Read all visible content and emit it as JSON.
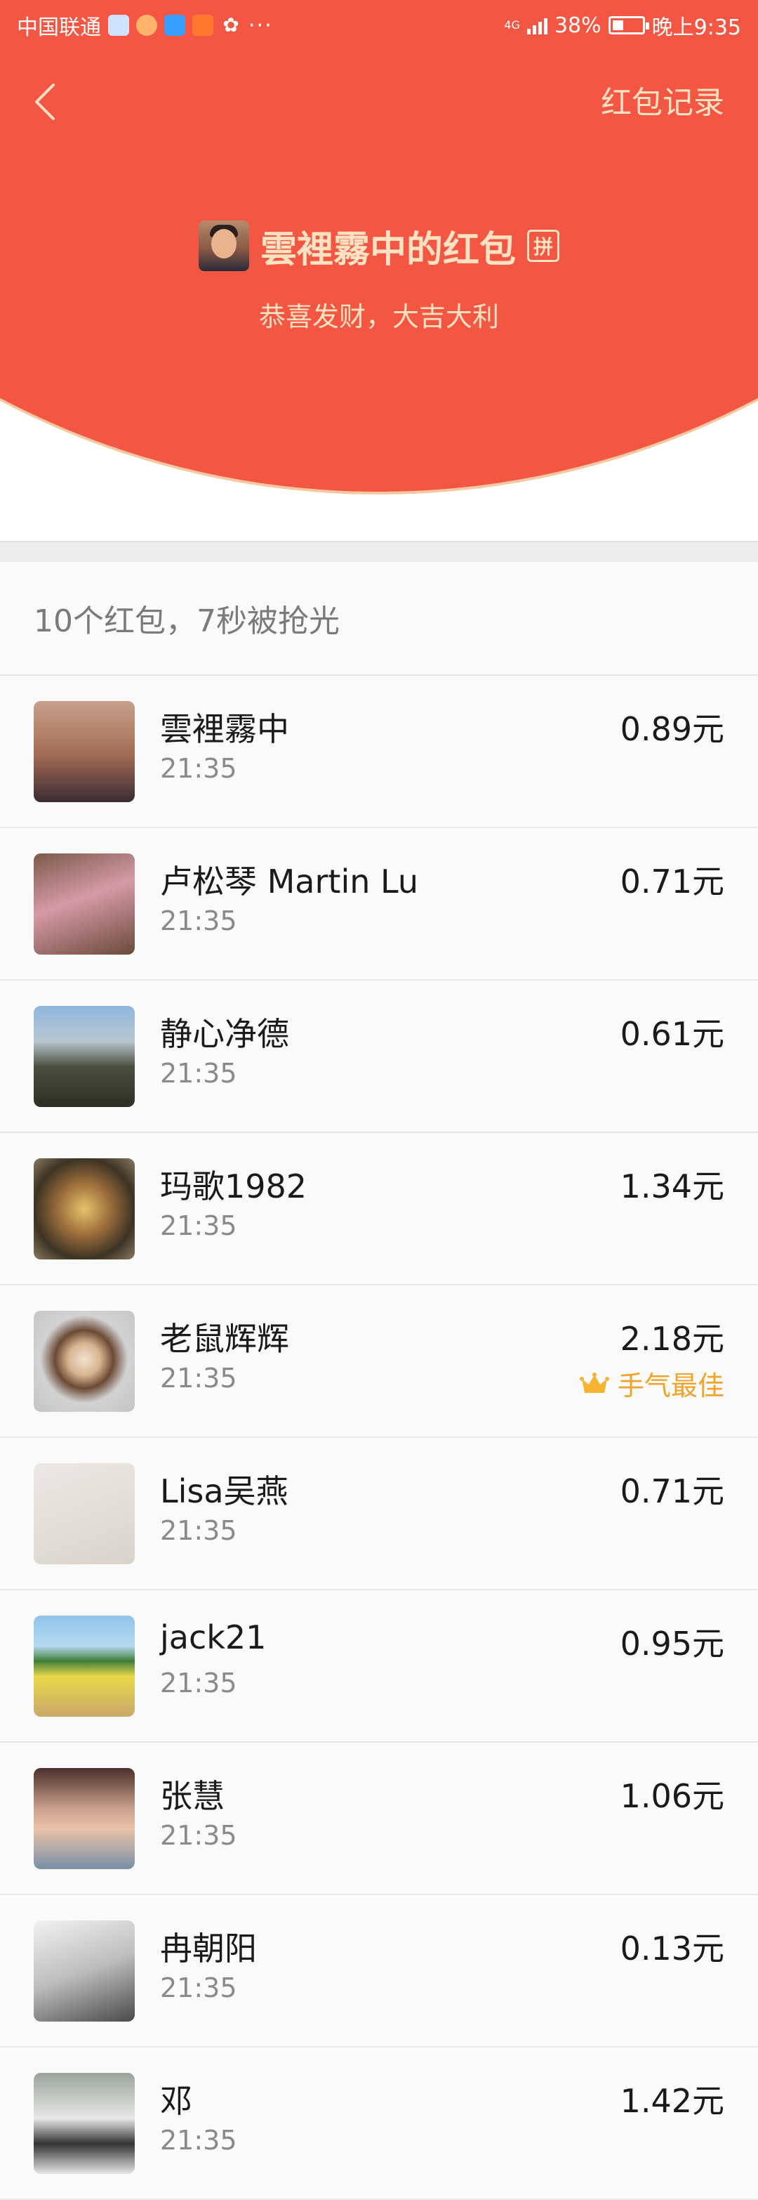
{
  "status_bar": {
    "carrier": "中国联通",
    "network": "4G",
    "battery": "38%",
    "battery_level": 0.38,
    "time": "晚上9:35",
    "more": "···"
  },
  "header": {
    "back_icon": "chevron-left-icon",
    "records_link": "红包记录",
    "sender_name": "雲裡霧中的红包",
    "pin_badge": "拼",
    "blessing": "恭喜发财，大吉大利"
  },
  "colors": {
    "header_red": "#f35643",
    "gold_text": "#fde2c2",
    "best_luck": "#f0a32b"
  },
  "summary": "10个红包，7秒被抢光",
  "recipients": [
    {
      "name": "雲裡霧中",
      "time": "21:35",
      "amount": "0.89元"
    },
    {
      "name": "卢松琴 Martin Lu",
      "time": "21:35",
      "amount": "0.71元"
    },
    {
      "name": "静心净德",
      "time": "21:35",
      "amount": "0.61元"
    },
    {
      "name": "玛歌1982",
      "time": "21:35",
      "amount": "1.34元"
    },
    {
      "name": "老鼠辉辉",
      "time": "21:35",
      "amount": "2.18元",
      "badge": "手气最佳",
      "badge_icon": "crown-icon"
    },
    {
      "name": "Lisa吴燕",
      "time": "21:35",
      "amount": "0.71元"
    },
    {
      "name": "jack21",
      "time": "21:35",
      "amount": "0.95元"
    },
    {
      "name": "张慧",
      "time": "21:35",
      "amount": "1.06元"
    },
    {
      "name": "冉朝阳",
      "time": "21:35",
      "amount": "0.13元"
    },
    {
      "name": "邓",
      "time": "21:35",
      "amount": "1.42元"
    }
  ]
}
